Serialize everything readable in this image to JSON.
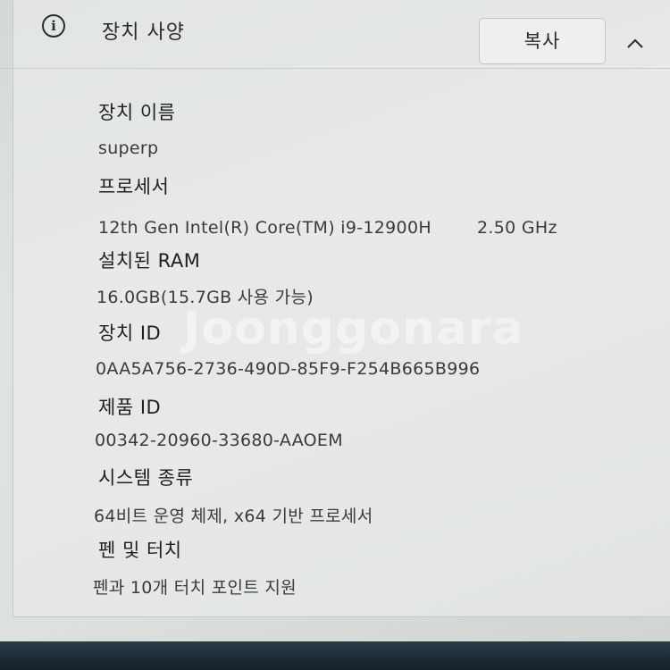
{
  "section": {
    "title": "장치 사양",
    "info_icon": "info-icon",
    "copy_label": "복사",
    "collapse_icon": "chevron-up-icon"
  },
  "specs": [
    {
      "label": "장치 이름",
      "value": "superp"
    },
    {
      "label": "프로세서",
      "value": "12th Gen Intel(R) Core(TM) i9-12900H",
      "extra": "2.50 GHz"
    },
    {
      "label": "설치된 RAM",
      "value": "16.0GB(15.7GB 사용 가능)"
    },
    {
      "label": "장치 ID",
      "value": "0AA5A756-2736-490D-85F9-F254B665B996"
    },
    {
      "label": "제품 ID",
      "value": "00342-20960-33680-AAOEM"
    },
    {
      "label": "시스템 종류",
      "value": "64비트 운영 체제, x64 기반 프로세서"
    },
    {
      "label": "펜 및 터치",
      "value": "펜과 10개 터치 포인트 지원"
    }
  ],
  "watermark": "Joonggonara",
  "colors": {
    "background": "#dde1de",
    "text": "#1f1f1f",
    "taskbar": "#1b2630"
  }
}
